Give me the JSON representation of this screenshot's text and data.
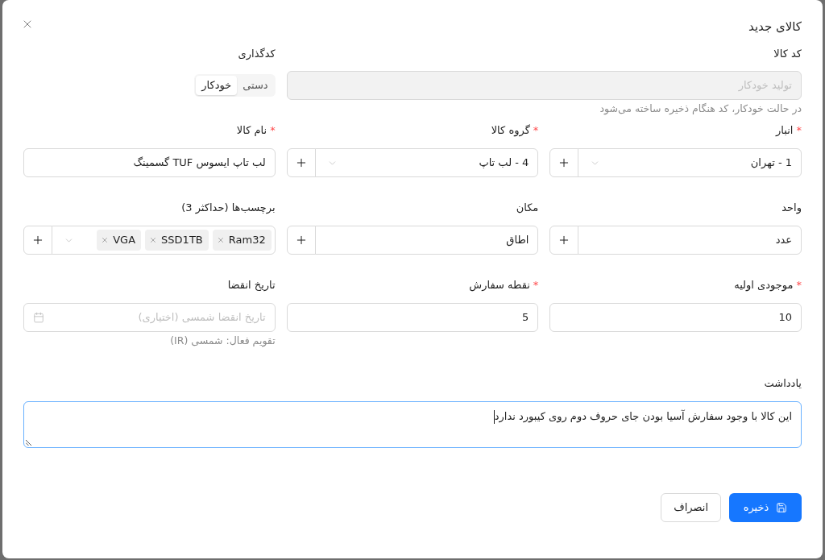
{
  "dialog": {
    "title": "کالای جدید"
  },
  "code": {
    "label": "کد کالا",
    "placeholder": "تولید خودکار",
    "disabled": true,
    "help": "در حالت خودکار، کد هنگام ذخیره ساخته می‌شود"
  },
  "coding_mode": {
    "label": "کدگذاری",
    "options": [
      {
        "label": "دستی",
        "selected": false
      },
      {
        "label": "خودکار",
        "selected": true
      }
    ]
  },
  "rows": [
    [
      {
        "kind": "select",
        "label": "انبار",
        "required_mark": "*",
        "value": "1 - تهران",
        "add_button": true
      },
      {
        "kind": "select",
        "label": "گروه کالا",
        "required_mark": "*",
        "value": "4 - لب تاپ",
        "add_button": true
      },
      {
        "kind": "text",
        "label": "نام کالا",
        "required_mark": "*",
        "value": "لب تاپ ایسوس TUF گسمینگ",
        "add_button": false
      }
    ],
    [
      {
        "kind": "text",
        "label": "واحد",
        "value": "عدد",
        "add_button": true
      },
      {
        "kind": "text",
        "label": "مکان",
        "value": "اطاق",
        "add_button": true
      },
      {
        "kind": "tags",
        "label": "برچسب‌ها (حداکثر 3)",
        "tags": [
          "Ram32",
          "SSD1TB",
          "VGA"
        ],
        "add_button": true
      }
    ],
    [
      {
        "kind": "text",
        "label": "موجودی اولیه",
        "required_mark": "*",
        "value": "10",
        "add_button": false
      },
      {
        "kind": "text",
        "label": "نقطه سفارش",
        "required_mark": "*",
        "value": "5",
        "add_button": false
      },
      {
        "kind": "date",
        "label": "تاریخ انقضا",
        "placeholder": "تاریخ انقضا شمسی (اختیاری)",
        "help": "تقویم فعال: شمسی (IR)",
        "add_button": false
      }
    ]
  ],
  "note": {
    "label": "یادداشت",
    "value": "این کالا با وجود سفارش آسیا بودن جای حروف دوم روی کیبورد ندارد",
    "focused": true
  },
  "buttons": [
    {
      "kind": "primary",
      "label": "ذخیره"
    },
    {
      "kind": "default",
      "label": "انصراف"
    }
  ]
}
